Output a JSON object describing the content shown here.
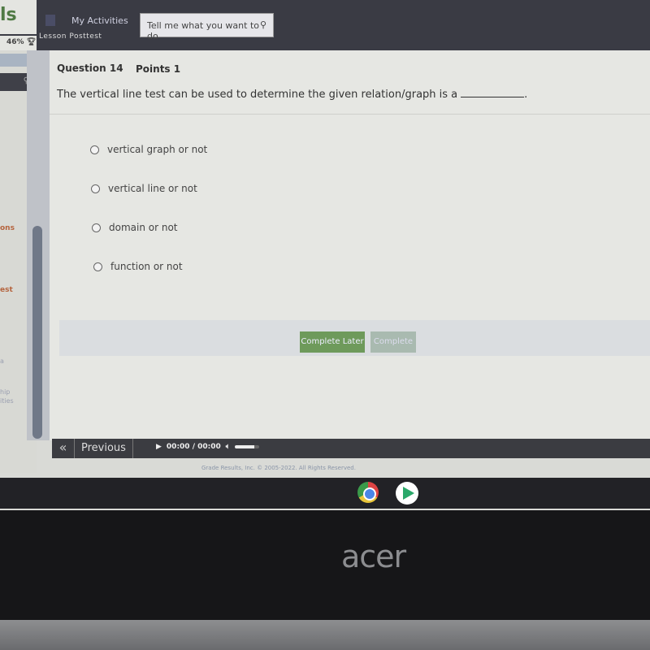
{
  "app": {
    "logo_text": "ls",
    "progress_percent": "46%",
    "nav_activities": "My Activities",
    "breadcrumb": "Lesson Posttest"
  },
  "search": {
    "placeholder": "Tell me what you want to do"
  },
  "sidebar": {
    "items": [
      "ons",
      "est",
      "a",
      "hip",
      "ities"
    ]
  },
  "question": {
    "number": "Question 14",
    "points": "Points 1",
    "text": "The vertical line test can be used to determine the given relation/graph is a",
    "options": [
      "vertical graph or not",
      "vertical line or not",
      "domain or not",
      "function or not"
    ]
  },
  "buttons": {
    "complete_later": "Complete Later",
    "complete": "Complete"
  },
  "nav": {
    "previous": "Previous",
    "back_glyph": "«"
  },
  "player": {
    "time": "00:00 / 00:00",
    "volume_level": 0.8
  },
  "footer": {
    "copyright": "Grade Results, Inc. © 2005-2022. All Rights Reserved."
  },
  "device": {
    "brand": "acer"
  }
}
